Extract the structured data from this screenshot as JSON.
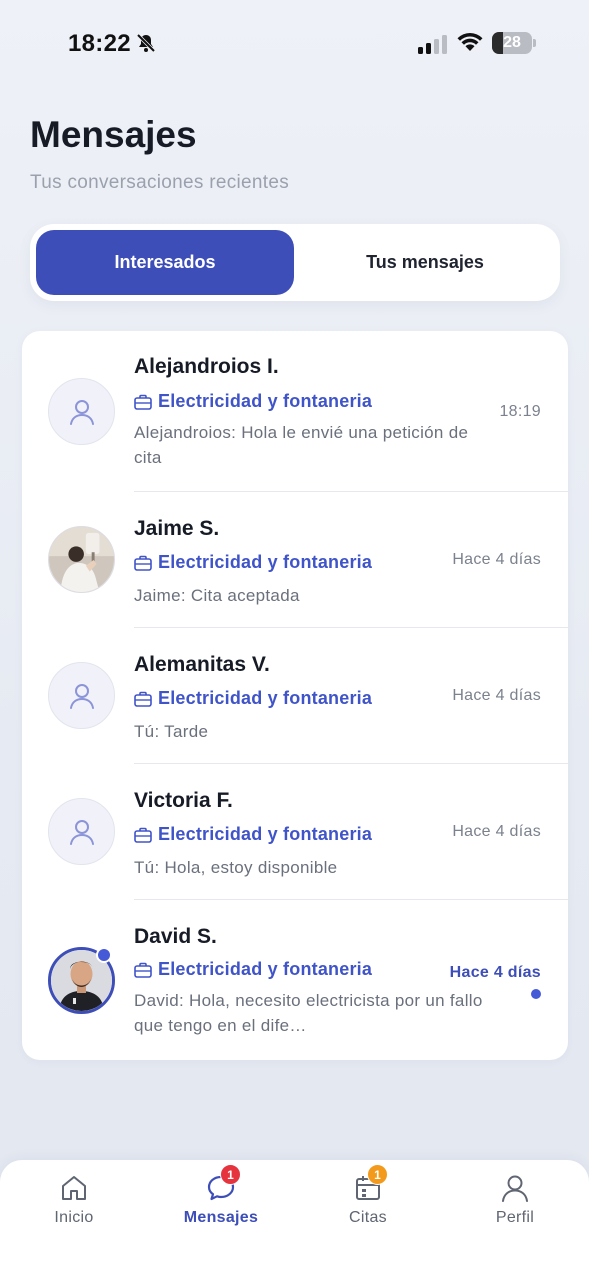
{
  "status_bar": {
    "time": "18:22",
    "battery": "28",
    "battery_level": 0.28
  },
  "header": {
    "title": "Mensajes",
    "subtitle": "Tus conversaciones recientes"
  },
  "tabs": [
    {
      "label": "Interesados",
      "active": true
    },
    {
      "label": "Tus mensajes",
      "active": false
    }
  ],
  "conversations": [
    {
      "name": "Alejandroios I.",
      "category": "Electricidad y fontaneria",
      "message": "Alejandroios: Hola le envié una petición de cita",
      "time": "18:19",
      "avatar": "placeholder",
      "unread": false
    },
    {
      "name": "Jaime S.",
      "category": "Electricidad y fontaneria",
      "message": "Jaime: Cita aceptada",
      "time": "Hace 4 días",
      "avatar": "photo",
      "unread": false
    },
    {
      "name": "Alemanitas V.",
      "category": "Electricidad y fontaneria",
      "message": "Tú: Tarde",
      "time": "Hace 4 días",
      "avatar": "placeholder",
      "unread": false
    },
    {
      "name": "Victoria F.",
      "category": "Electricidad y fontaneria",
      "message": "Tú: Hola, estoy disponible",
      "time": "Hace 4 días",
      "avatar": "placeholder",
      "unread": false
    },
    {
      "name": "David S.",
      "category": "Electricidad y fontaneria",
      "message": "David: Hola, necesito electricista por un fallo que tengo en el dife…",
      "time": "Hace 4 días",
      "avatar": "photo",
      "unread": true
    }
  ],
  "bottom_nav": [
    {
      "label": "Inicio",
      "icon": "home-icon",
      "active": false
    },
    {
      "label": "Mensajes",
      "icon": "chat-icon",
      "active": true,
      "badge": "1"
    },
    {
      "label": "Citas",
      "icon": "calendar-icon",
      "active": false,
      "badge": "1"
    },
    {
      "label": "Perfil",
      "icon": "user-icon",
      "active": false
    }
  ],
  "colors": {
    "accent": "#3d4eb8",
    "badge_red": "#e5343d",
    "badge_orange": "#f39a1c"
  }
}
